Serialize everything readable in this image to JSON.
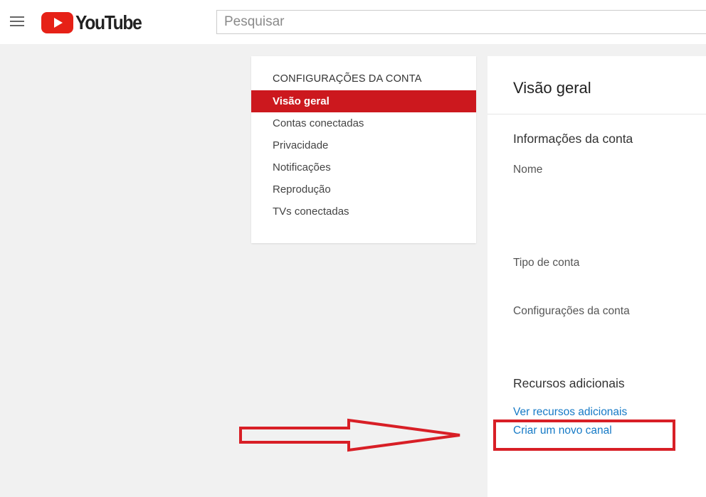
{
  "header": {
    "logo_text": "YouTube",
    "search_placeholder": "Pesquisar"
  },
  "settings_nav": {
    "heading": "CONFIGURAÇÕES DA CONTA",
    "items": [
      {
        "label": "Visão geral",
        "active": true
      },
      {
        "label": "Contas conectadas",
        "active": false
      },
      {
        "label": "Privacidade",
        "active": false
      },
      {
        "label": "Notificações",
        "active": false
      },
      {
        "label": "Reprodução",
        "active": false
      },
      {
        "label": "TVs conectadas",
        "active": false
      }
    ]
  },
  "main": {
    "title": "Visão geral",
    "account_info_title": "Informações da conta",
    "name_label": "Nome",
    "account_type_label": "Tipo de conta",
    "account_settings_label": "Configurações da conta",
    "additional_resources_title": "Recursos adicionais",
    "see_resources_link": "Ver recursos adicionais",
    "create_channel_link": "Criar um novo canal"
  },
  "colors": {
    "brand_red": "#e62117",
    "active_nav": "#cc181e",
    "link_blue": "#167ac6",
    "annotation_red": "#d81f26"
  },
  "icons": [
    "menu-icon",
    "youtube-play-icon"
  ]
}
